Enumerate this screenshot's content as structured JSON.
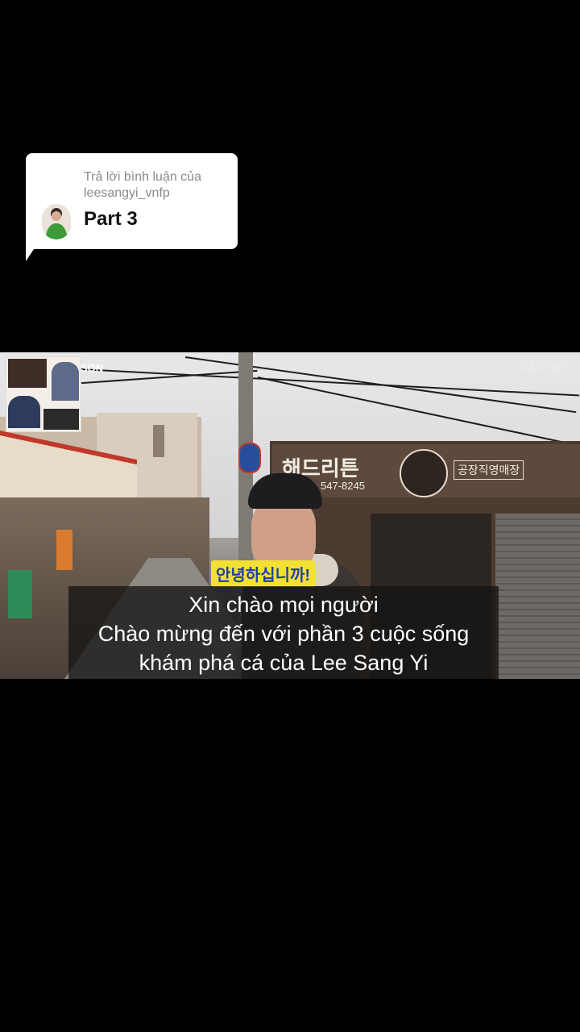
{
  "reply": {
    "header": "Trả lời bình luận của leesangyi_vnfp",
    "text": "Part 3"
  },
  "video": {
    "korean_caption": "안녕하십니까!",
    "channel_mark": "SON",
    "watermark_line1": "이상이 배우",
    "watermark_line2": "",
    "store_name": "해드리튼",
    "store_phone": "547-8245",
    "store_subtitle": "공장직영매장",
    "subtitle_lines": [
      "Xin chào mọi người",
      "Chào mừng đến với phần 3 cuộc sống",
      "khám phá cá của Lee Sang Yi"
    ]
  },
  "colors": {
    "background": "#000000",
    "bubble": "#ffffff",
    "caption_bg": "#f2e033",
    "caption_text": "#1f3fa6"
  }
}
